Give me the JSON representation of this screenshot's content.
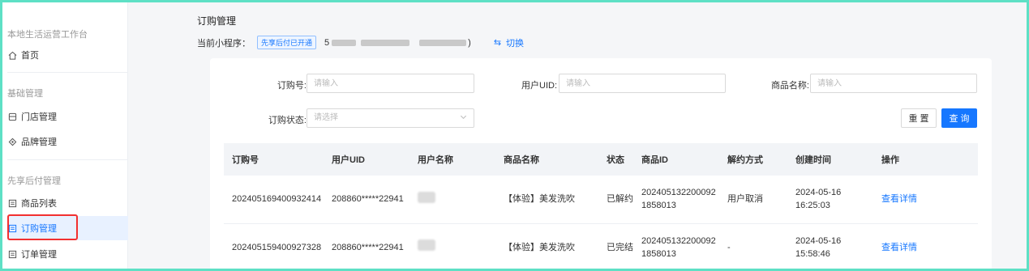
{
  "sidebar": {
    "workspace_title": "本地生活运营工作台",
    "home": "首页",
    "section_basic": "基础管理",
    "store_mgmt": "门店管理",
    "brand_mgmt": "品牌管理",
    "section_prepaid": "先享后付管理",
    "product_list": "商品列表",
    "order_sub_mgmt": "订购管理",
    "order_mgmt": "订单管理"
  },
  "header": {
    "title": "订购管理",
    "mini_label": "当前小程序：",
    "badge": "先享后付已开通",
    "mini_prefix": "5",
    "mini_suffix": ")",
    "switch_label": "切换"
  },
  "filters": {
    "order_no_label": "订购号:",
    "order_no_placeholder": "请输入",
    "uid_label": "用户UID:",
    "uid_placeholder": "请输入",
    "product_name_label": "商品名称:",
    "product_name_placeholder": "请输入",
    "status_label": "订购状态:",
    "status_placeholder": "请选择",
    "reset_label": "重 置",
    "query_label": "查 询"
  },
  "table": {
    "columns": [
      "订购号",
      "用户UID",
      "用户名称",
      "商品名称",
      "状态",
      "商品ID",
      "解约方式",
      "创建时间",
      "操作"
    ],
    "rows": [
      {
        "order_no": "202405169400932414",
        "uid": "208860*****22941",
        "product_name": "【体验】美发洗吹",
        "status": "已解约",
        "product_id_1": "202405132200092",
        "product_id_2": "1858013",
        "termination": "用户取消",
        "date": "2024-05-16",
        "time": "16:25:03",
        "action": "查看详情"
      },
      {
        "order_no": "202405159400927328",
        "uid": "208860*****22941",
        "product_name": "【体验】美发洗吹",
        "status": "已完结",
        "product_id_1": "202405132200092",
        "product_id_2": "1858013",
        "termination": "-",
        "date": "2024-05-16",
        "time": "15:58:46",
        "action": "查看详情"
      }
    ]
  },
  "colors": {
    "accent": "#1677ff",
    "highlight_border": "#f23030",
    "frame": "#5ee0c5"
  }
}
